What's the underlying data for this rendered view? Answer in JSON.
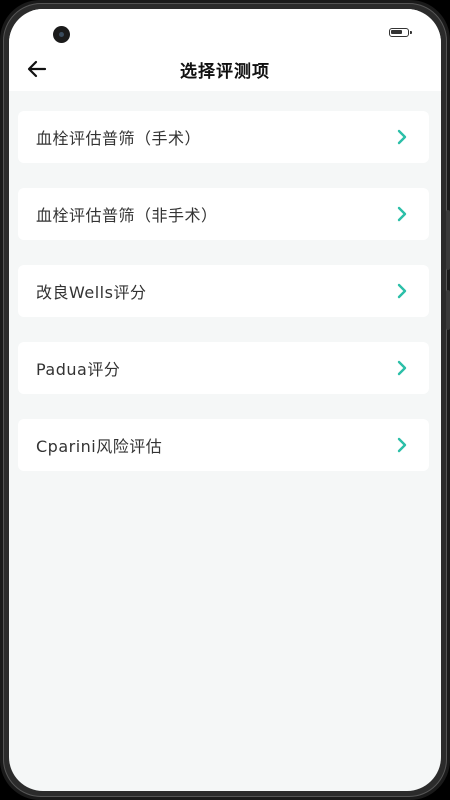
{
  "nav": {
    "title": "选择评测项",
    "back_icon": "arrow-left-icon"
  },
  "items": [
    {
      "label": "血栓评估普筛（手术）"
    },
    {
      "label": "血栓评估普筛（非手术）"
    },
    {
      "label": "改良Wells评分"
    },
    {
      "label": "Padua评分"
    },
    {
      "label": "Cparini风险评估"
    }
  ],
  "colors": {
    "accent": "#2bbfa8",
    "background": "#f5f7f7",
    "card": "#ffffff",
    "text": "#333333"
  }
}
